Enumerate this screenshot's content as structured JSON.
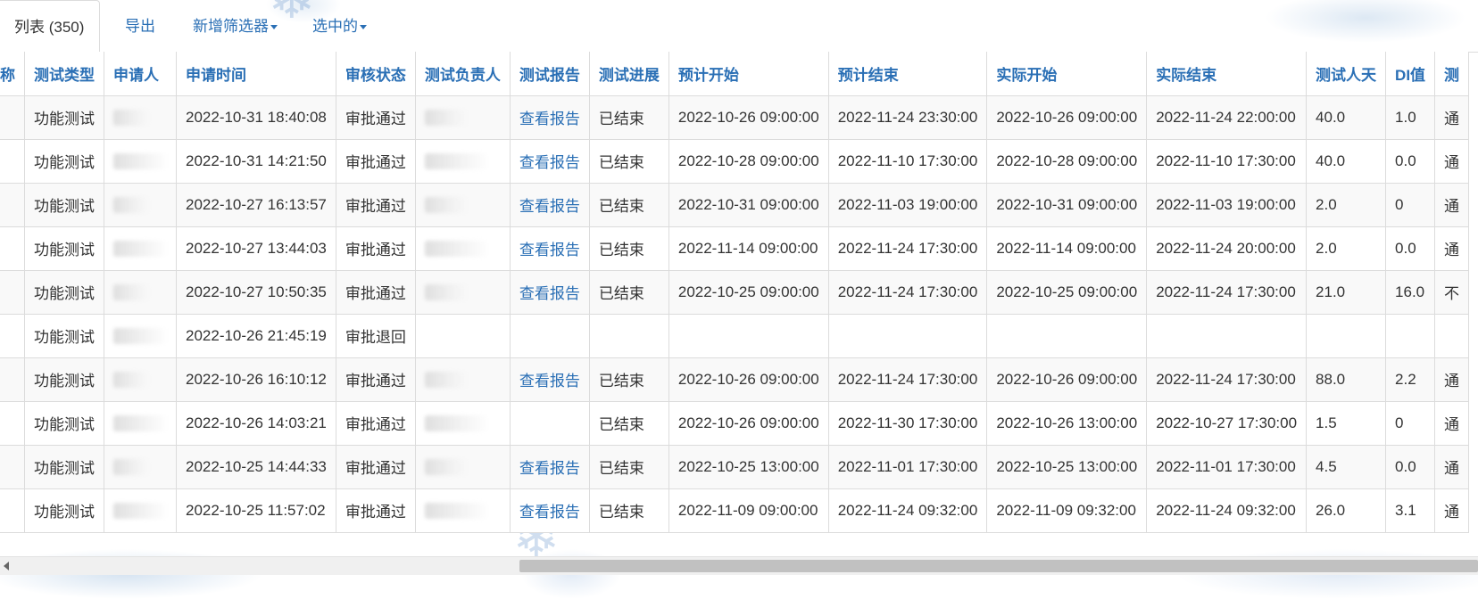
{
  "tabs": [
    {
      "label": "列表 (350)",
      "active": true
    },
    {
      "label": "导出",
      "active": false
    },
    {
      "label": "新增筛选器",
      "active": false,
      "dropdown": true
    },
    {
      "label": "选中的",
      "active": false,
      "dropdown": true
    }
  ],
  "table": {
    "headers": [
      "称",
      "测试类型",
      "申请人",
      "申请时间",
      "审核状态",
      "测试负责人",
      "测试报告",
      "测试进展",
      "预计开始",
      "预计结束",
      "实际开始",
      "实际结束",
      "测试人天",
      "DI值",
      "测"
    ],
    "rows": [
      [
        "",
        "功能测试",
        "",
        "2022-10-31 18:40:08",
        "审批通过",
        "",
        "查看报告",
        "已结束",
        "2022-10-26 09:00:00",
        "2022-11-24 23:30:00",
        "2022-10-26 09:00:00",
        "2022-11-24 22:00:00",
        "40.0",
        "1.0",
        "通"
      ],
      [
        "",
        "功能测试",
        "",
        "2022-10-31 14:21:50",
        "审批通过",
        "",
        "查看报告",
        "已结束",
        "2022-10-28 09:00:00",
        "2022-11-10 17:30:00",
        "2022-10-28 09:00:00",
        "2022-11-10 17:30:00",
        "40.0",
        "0.0",
        "通"
      ],
      [
        "",
        "功能测试",
        "",
        "2022-10-27 16:13:57",
        "审批通过",
        "",
        "查看报告",
        "已结束",
        "2022-10-31 09:00:00",
        "2022-11-03 19:00:00",
        "2022-10-31 09:00:00",
        "2022-11-03 19:00:00",
        "2.0",
        "0",
        "通"
      ],
      [
        "",
        "功能测试",
        "",
        "2022-10-27 13:44:03",
        "审批通过",
        "",
        "查看报告",
        "已结束",
        "2022-11-14 09:00:00",
        "2022-11-24 17:30:00",
        "2022-11-14 09:00:00",
        "2022-11-24 20:00:00",
        "2.0",
        "0.0",
        "通"
      ],
      [
        "",
        "功能测试",
        "",
        "2022-10-27 10:50:35",
        "审批通过",
        "",
        "查看报告",
        "已结束",
        "2022-10-25 09:00:00",
        "2022-11-24 17:30:00",
        "2022-10-25 09:00:00",
        "2022-11-24 17:30:00",
        "21.0",
        "16.0",
        "不"
      ],
      [
        "",
        "功能测试",
        "",
        "2022-10-26 21:45:19",
        "审批退回",
        "",
        "",
        "",
        "",
        "",
        "",
        "",
        "",
        "",
        ""
      ],
      [
        "",
        "功能测试",
        "",
        "2022-10-26 16:10:12",
        "审批通过",
        "",
        "查看报告",
        "已结束",
        "2022-10-26 09:00:00",
        "2022-11-24 17:30:00",
        "2022-10-26 09:00:00",
        "2022-11-24 17:30:00",
        "88.0",
        "2.2",
        "通"
      ],
      [
        "",
        "功能测试",
        "",
        "2022-10-26 14:03:21",
        "审批通过",
        "",
        "",
        "已结束",
        "2022-10-26 09:00:00",
        "2022-11-30 17:30:00",
        "2022-10-26 13:00:00",
        "2022-10-27 17:30:00",
        "1.5",
        "0",
        "通"
      ],
      [
        "",
        "功能测试",
        "",
        "2022-10-25 14:44:33",
        "审批通过",
        "",
        "查看报告",
        "已结束",
        "2022-10-25 13:00:00",
        "2022-11-01 17:30:00",
        "2022-10-25 13:00:00",
        "2022-11-01 17:30:00",
        "4.5",
        "0.0",
        "通"
      ],
      [
        "",
        "功能测试",
        "",
        "2022-10-25 11:57:02",
        "审批通过",
        "",
        "查看报告",
        "已结束",
        "2022-11-09 09:00:00",
        "2022-11-24 09:32:00",
        "2022-11-09 09:32:00",
        "2022-11-24 09:32:00",
        "26.0",
        "3.1",
        "通"
      ]
    ]
  },
  "colors": {
    "link": "#2a6fb5",
    "text": "#333333",
    "border": "#dcdcdc",
    "row_stripe": "#f9f9f9"
  }
}
